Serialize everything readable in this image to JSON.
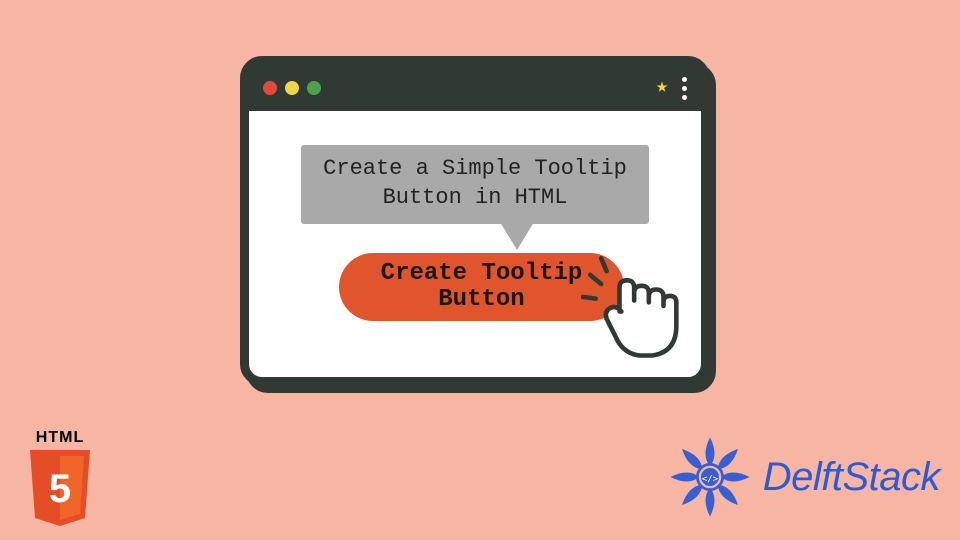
{
  "window": {
    "tooltip_text": "Create a Simple Tooltip Button in HTML",
    "button_label": "Create Tooltip Button",
    "dot_colors": {
      "red": "#e24a3b",
      "yellow": "#eed644",
      "green": "#4aa24a"
    },
    "star_icon": "★"
  },
  "badges": {
    "html5_label": "HTML",
    "html5_number": "5",
    "html5_shield_color": "#e44d26",
    "html5_shield_light": "#f16529"
  },
  "brand": {
    "name": "DelftStack",
    "color": "#2d5bd6"
  }
}
